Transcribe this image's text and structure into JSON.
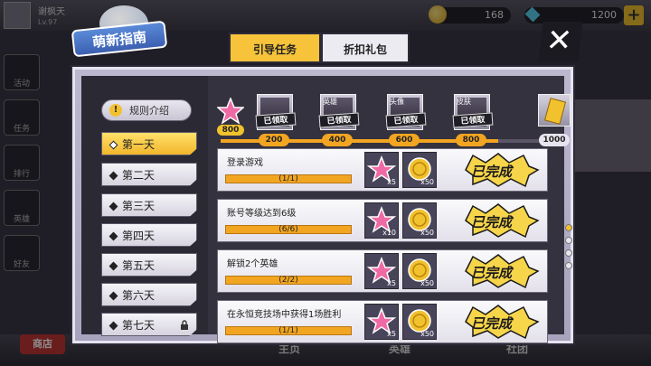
{
  "header": {
    "player_name": "谢枫天",
    "player_level": "Lv.97",
    "gold": "168",
    "gems": "1200"
  },
  "title": "萌新指南",
  "tabs": [
    {
      "label": "引导任务",
      "active": true
    },
    {
      "label": "折扣礼包",
      "active": false
    }
  ],
  "rules_label": "规则介绍",
  "days": [
    {
      "label": "第一天",
      "active": true,
      "locked": false
    },
    {
      "label": "第二天",
      "active": false,
      "locked": false
    },
    {
      "label": "第三天",
      "active": false,
      "locked": false
    },
    {
      "label": "第四天",
      "active": false,
      "locked": false
    },
    {
      "label": "第五天",
      "active": false,
      "locked": false
    },
    {
      "label": "第六天",
      "active": false,
      "locked": false
    },
    {
      "label": "第七天",
      "active": false,
      "locked": true
    }
  ],
  "progress": {
    "current": "800",
    "fill_fraction": 0.8,
    "milestones": [
      {
        "value": "200",
        "reward_name": "",
        "claimed_label": "已领取"
      },
      {
        "value": "400",
        "reward_name": "英雄",
        "claimed_label": "已领取"
      },
      {
        "value": "600",
        "reward_name": "头像",
        "claimed_label": "已领取"
      },
      {
        "value": "800",
        "reward_name": "皮肤",
        "claimed_label": "已领取"
      },
      {
        "value": "1000",
        "reward_name": "",
        "claimed_label": ""
      }
    ]
  },
  "tasks": [
    {
      "title": "登录游戏",
      "progress": "(1/1)",
      "rewards": [
        "x5",
        "x50"
      ],
      "status": "已完成"
    },
    {
      "title": "账号等级达到6级",
      "progress": "(6/6)",
      "rewards": [
        "x10",
        "x50"
      ],
      "status": "已完成"
    },
    {
      "title": "解锁2个英雄",
      "progress": "(2/2)",
      "rewards": [
        "x5",
        "x50"
      ],
      "status": "已完成"
    },
    {
      "title": "在永恒竞技场中获得1场胜利",
      "progress": "(1/1)",
      "rewards": [
        "x5",
        "x50"
      ],
      "status": "已完成"
    }
  ],
  "background": {
    "side_buttons": [
      "活动",
      "任务",
      "排行",
      "英雄",
      "好友"
    ],
    "shop_label": "商店",
    "bottom_tabs": [
      "主页",
      "英雄",
      "社团"
    ]
  },
  "colors": {
    "accent": "#f2c12e",
    "progress": "#f2a521",
    "panel": "#35323f"
  }
}
